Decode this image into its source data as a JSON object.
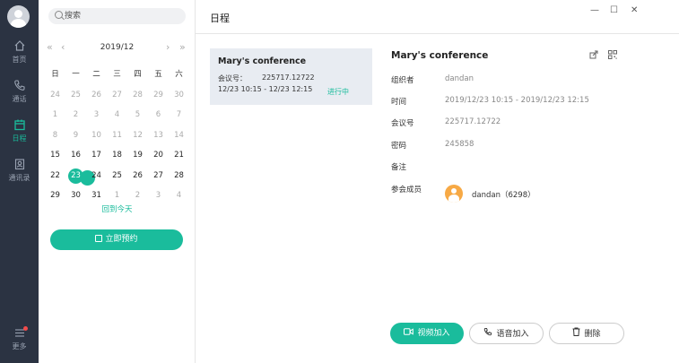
{
  "nav": {
    "items": [
      {
        "label": "首页",
        "icon": "home-icon"
      },
      {
        "label": "通话",
        "icon": "phone-icon"
      },
      {
        "label": "日程",
        "icon": "calendar-icon",
        "active": true
      },
      {
        "label": "通讯录",
        "icon": "contacts-icon"
      }
    ],
    "more_label": "更多"
  },
  "search": {
    "placeholder": "搜索"
  },
  "calendar": {
    "month_title": "2019/12",
    "prev_year": "«",
    "prev_month": "‹",
    "next_month": "›",
    "next_year": "»",
    "weekdays": [
      "日",
      "一",
      "二",
      "三",
      "四",
      "五",
      "六"
    ],
    "weeks": [
      [
        {
          "d": "24",
          "t": "dim"
        },
        {
          "d": "25",
          "t": "dim"
        },
        {
          "d": "26",
          "t": "dim"
        },
        {
          "d": "27",
          "t": "dim"
        },
        {
          "d": "28",
          "t": "dim"
        },
        {
          "d": "29",
          "t": "dim"
        },
        {
          "d": "30",
          "t": "dim"
        }
      ],
      [
        {
          "d": "1",
          "t": "dim"
        },
        {
          "d": "2",
          "t": "dim"
        },
        {
          "d": "3",
          "t": "dim"
        },
        {
          "d": "4",
          "t": "dim"
        },
        {
          "d": "5",
          "t": "dim"
        },
        {
          "d": "6",
          "t": "dim"
        },
        {
          "d": "7",
          "t": "dim"
        }
      ],
      [
        {
          "d": "8",
          "t": "dim"
        },
        {
          "d": "9",
          "t": "dim"
        },
        {
          "d": "10",
          "t": "dim"
        },
        {
          "d": "11",
          "t": "dim"
        },
        {
          "d": "12",
          "t": "dim"
        },
        {
          "d": "13",
          "t": "dim"
        },
        {
          "d": "14",
          "t": "dim"
        }
      ],
      [
        {
          "d": "15",
          "t": "cur"
        },
        {
          "d": "16",
          "t": "cur"
        },
        {
          "d": "17",
          "t": "cur"
        },
        {
          "d": "18",
          "t": "cur"
        },
        {
          "d": "19",
          "t": "cur"
        },
        {
          "d": "20",
          "t": "cur"
        },
        {
          "d": "21",
          "t": "cur"
        }
      ],
      [
        {
          "d": "22",
          "t": "cur"
        },
        {
          "d": "23",
          "t": "today"
        },
        {
          "d": "24",
          "t": "cur"
        },
        {
          "d": "25",
          "t": "cur"
        },
        {
          "d": "26",
          "t": "cur"
        },
        {
          "d": "27",
          "t": "cur"
        },
        {
          "d": "28",
          "t": "cur"
        }
      ],
      [
        {
          "d": "29",
          "t": "cur"
        },
        {
          "d": "30",
          "t": "cur"
        },
        {
          "d": "31",
          "t": "cur"
        },
        {
          "d": "1",
          "t": "dim"
        },
        {
          "d": "2",
          "t": "dim"
        },
        {
          "d": "3",
          "t": "dim"
        },
        {
          "d": "4",
          "t": "dim"
        }
      ]
    ],
    "back_today": "回到今天",
    "book_now": "立即预约"
  },
  "main": {
    "title": "日程",
    "window": {
      "minimize": "—",
      "maximize": "☐",
      "close": "✕"
    }
  },
  "meeting_card": {
    "title": "Mary's conference",
    "id_label": "会议号：",
    "id_value": "225717.12722",
    "time": "12/23 10:15 - 12/23 12:15",
    "status": "进行中"
  },
  "detail": {
    "title": "Mary's conference",
    "organizer_label": "组织者",
    "organizer_value": "dandan",
    "time_label": "时间",
    "time_value": "2019/12/23 10:15 - 2019/12/23 12:15",
    "meeting_id_label": "会议号",
    "meeting_id_value": "225717.12722",
    "password_label": "密码",
    "password_value": "245858",
    "note_label": "备注",
    "note_value": "",
    "members_label": "参会成员",
    "members": [
      {
        "name": "dandan（6298）"
      }
    ]
  },
  "actions": {
    "video_join": "视频加入",
    "voice_join": "语音加入",
    "delete": "删除"
  },
  "colors": {
    "accent": "#1abc9c",
    "nav_bg": "#2b3342",
    "badge": "#f24b4b",
    "member_avatar": "#f7a945"
  }
}
